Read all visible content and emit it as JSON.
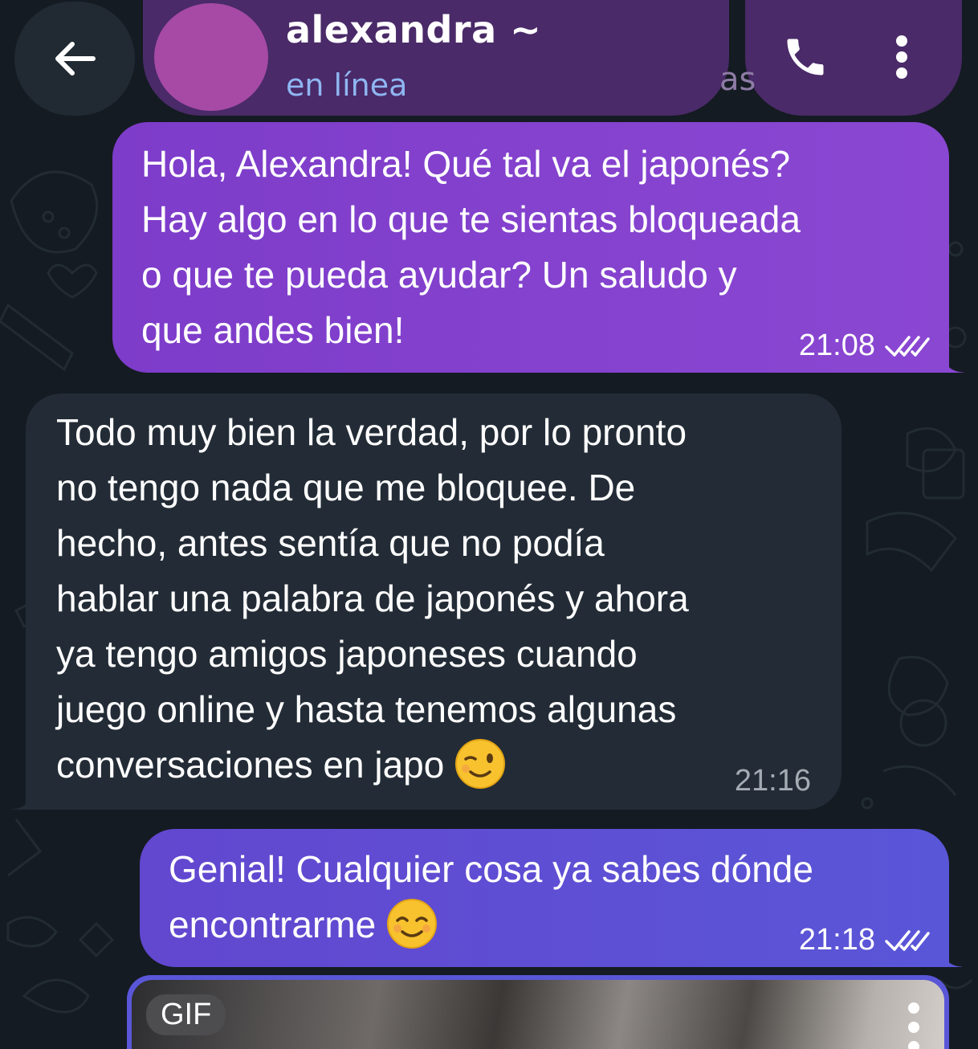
{
  "header": {
    "contact_name": "alexandra ~",
    "status": "en línea",
    "peek_text": "as",
    "avatar_color": "#a64aa6",
    "back_icon": "arrow-left-icon",
    "call_icon": "phone-icon",
    "menu_icon": "vertical-dots-icon"
  },
  "messages": [
    {
      "direction": "outgoing",
      "text": "Hola, Alexandra! Qué tal va el japonés?\nHay algo en lo que te sientas bloqueada\no que te pueda ayudar? Un saludo y\nque andes bien!",
      "time": "21:08",
      "status_icon": "double-check-icon"
    },
    {
      "direction": "incoming",
      "text": "Todo muy bien la verdad, por lo pronto\nno tengo nada que me bloquee. De\nhecho, antes sentía que no podía\nhablar una palabra de japonés y ahora\nya tengo amigos japoneses cuando\njuego online y hasta tenemos algunas\nconversaciones en japo ",
      "emoji": "winking-face-emoji",
      "time": "21:16"
    },
    {
      "direction": "outgoing",
      "text": "Genial! Cualquier cosa ya sabes dónde\nencontrarme ",
      "emoji": "smiling-face-emoji",
      "time": "21:18",
      "status_icon": "double-check-icon"
    }
  ],
  "gif": {
    "badge": "GIF",
    "menu_icon": "vertical-dots-icon"
  },
  "colors": {
    "background": "#141b22",
    "outgoing_bubble": "#8a47d2",
    "outgoing_bubble_2": "#5a56d8",
    "incoming_bubble": "#232c36",
    "header_pill": "#4a2a68",
    "status_text": "#8fb6f2"
  }
}
